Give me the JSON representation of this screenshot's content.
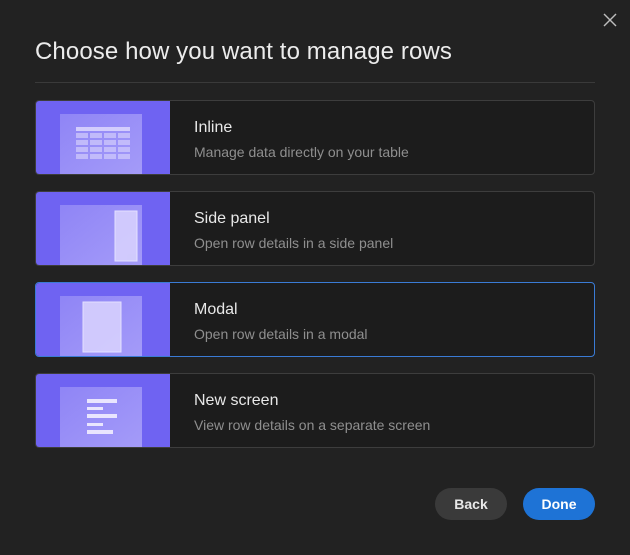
{
  "dialog": {
    "title": "Choose how you want to manage rows",
    "options": [
      {
        "label": "Inline",
        "description": "Manage data directly on your table",
        "icon": "inline-table-icon"
      },
      {
        "label": "Side panel",
        "description": "Open row details in a side panel",
        "icon": "side-panel-icon"
      },
      {
        "label": "Modal",
        "description": "Open row details in a modal",
        "icon": "modal-icon",
        "selected": true
      },
      {
        "label": "New screen",
        "description": "View row details on a separate screen",
        "icon": "new-screen-icon"
      }
    ],
    "back_label": "Back",
    "done_label": "Done"
  },
  "colors": {
    "accent": "#6f63f2",
    "selected_border": "#3a7bd5",
    "primary_button": "#1e73d6"
  }
}
